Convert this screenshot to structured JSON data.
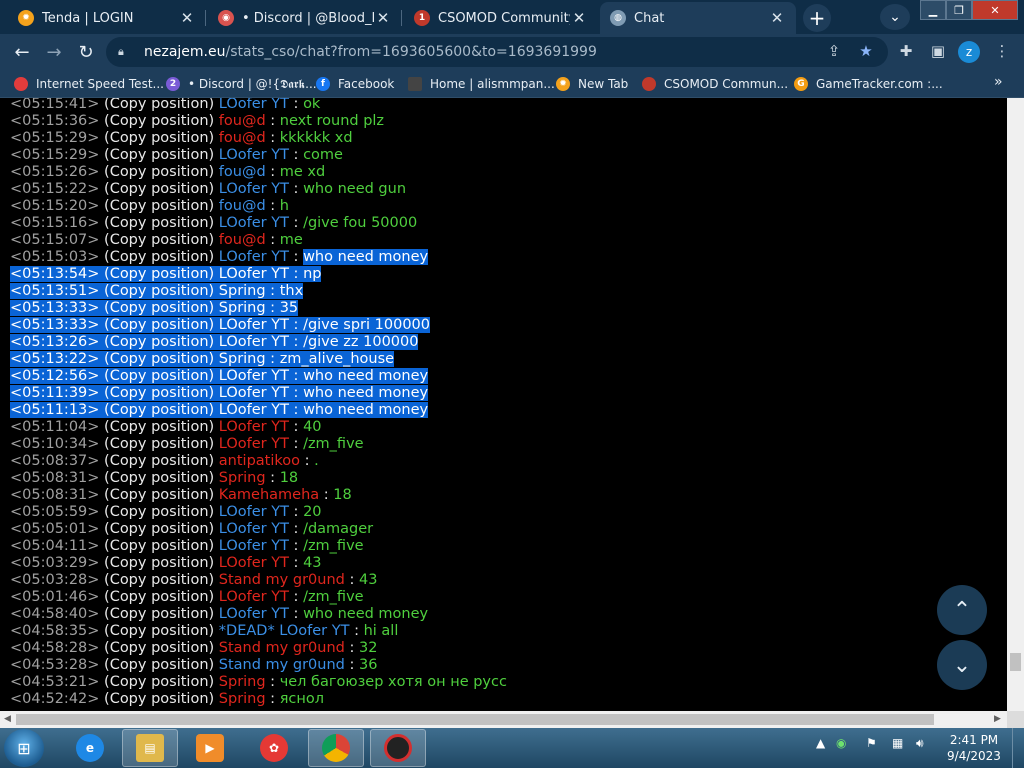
{
  "tabs": [
    {
      "title": "Tenda | LOGIN",
      "icon": "tenda-icon",
      "color": "#f4a21c",
      "badge": ""
    },
    {
      "title": "• Discord | @Blood_Band",
      "icon": "discord-icon",
      "color": "#d9534f",
      "badge": ""
    },
    {
      "title": "CSOMOD Community",
      "icon": "csomod-icon",
      "color": "#c0392b",
      "badge": "1"
    },
    {
      "title": "Chat",
      "icon": "globe-icon",
      "color": "#7f9bb3",
      "badge": ""
    }
  ],
  "address": {
    "host": "nezajem.eu",
    "path": "/stats_cso/chat?from=1693605600&to=1693691999"
  },
  "profile_initial": "z",
  "bookmarks": [
    {
      "label": "Internet Speed Test...",
      "icon": "speedtest-icon",
      "color": "#e23c3c"
    },
    {
      "label": "• Discord | @!{𝕯𝖆𝖗𝖐...",
      "icon": "discord-icon",
      "color": "#7a5bd6",
      "badge": "2"
    },
    {
      "label": "Facebook",
      "icon": "facebook-icon",
      "color": "#1877f2"
    },
    {
      "label": "Home | alismmpan...",
      "icon": "alism-icon",
      "color": "#444444"
    },
    {
      "label": "New Tab",
      "icon": "tenda-icon",
      "color": "#f4a21c"
    },
    {
      "label": "CSOMOD Commun...",
      "icon": "csomod-icon",
      "color": "#c0392b"
    },
    {
      "label": "GameTracker.com :...",
      "icon": "gametracker-icon",
      "color": "#f39c12"
    }
  ],
  "chat": {
    "copy_label": "(Copy position)",
    "separator": " : ",
    "rows": [
      {
        "time": "<05:15:41>",
        "name": "LOofer YT",
        "color": "blue",
        "msg": "ok",
        "hl": false
      },
      {
        "time": "<05:15:36>",
        "name": "fou@d",
        "color": "red",
        "msg": "next round plz",
        "hl": false
      },
      {
        "time": "<05:15:29>",
        "name": "fou@d",
        "color": "red",
        "msg": "kkkkkk xd",
        "hl": false
      },
      {
        "time": "<05:15:29>",
        "name": "LOofer YT",
        "color": "blue",
        "msg": "come",
        "hl": false
      },
      {
        "time": "<05:15:26>",
        "name": "fou@d",
        "color": "blue",
        "msg": "me xd",
        "hl": false
      },
      {
        "time": "<05:15:22>",
        "name": "LOofer YT",
        "color": "blue",
        "msg": "who need gun",
        "hl": false
      },
      {
        "time": "<05:15:20>",
        "name": "fou@d",
        "color": "blue",
        "msg": "h",
        "hl": false
      },
      {
        "time": "<05:15:16>",
        "name": "LOofer YT",
        "color": "blue",
        "msg": "/give fou 50000",
        "hl": false
      },
      {
        "time": "<05:15:07>",
        "name": "fou@d",
        "color": "red",
        "msg": "me",
        "hl": false
      },
      {
        "time": "<05:15:03>",
        "name": "LOofer YT",
        "color": "blue",
        "msg": "who need money",
        "hl": "partial"
      },
      {
        "time": "<05:13:54>",
        "name": "LOofer YT",
        "color": "blue",
        "msg": "np",
        "hl": true
      },
      {
        "time": "<05:13:51>",
        "name": "Spring",
        "color": "red",
        "msg": "thx",
        "hl": true
      },
      {
        "time": "<05:13:33>",
        "name": "Spring",
        "color": "red",
        "msg": "35",
        "hl": true
      },
      {
        "time": "<05:13:33>",
        "name": "LOofer YT",
        "color": "blue",
        "msg": "/give spri 100000",
        "hl": true
      },
      {
        "time": "<05:13:26>",
        "name": "LOofer YT",
        "color": "blue",
        "msg": "/give zz 100000",
        "hl": true
      },
      {
        "time": "<05:13:22>",
        "name": "Spring",
        "color": "red",
        "msg": "zm_alive_house",
        "hl": true
      },
      {
        "time": "<05:12:56>",
        "name": "LOofer YT",
        "color": "blue",
        "msg": "who need money",
        "hl": true
      },
      {
        "time": "<05:11:39>",
        "name": "LOofer YT",
        "color": "blue",
        "msg": "who need money",
        "hl": true
      },
      {
        "time": "<05:11:13>",
        "name": "LOofer YT",
        "color": "blue",
        "msg": "who need money",
        "hl": true
      },
      {
        "time": "<05:11:04>",
        "name": "LOofer YT",
        "color": "red",
        "msg": "40",
        "hl": false
      },
      {
        "time": "<05:10:34>",
        "name": "LOofer YT",
        "color": "red",
        "msg": "/zm_five",
        "hl": false
      },
      {
        "time": "<05:08:37>",
        "name": "antipatikoo",
        "color": "red",
        "msg": ".",
        "hl": false
      },
      {
        "time": "<05:08:31>",
        "name": "Spring",
        "color": "red",
        "msg": "18",
        "hl": false
      },
      {
        "time": "<05:08:31>",
        "name": "Kamehameha",
        "color": "red",
        "msg": "18",
        "hl": false
      },
      {
        "time": "<05:05:59>",
        "name": "LOofer YT",
        "color": "blue",
        "msg": "20",
        "hl": false
      },
      {
        "time": "<05:05:01>",
        "name": "LOofer YT",
        "color": "blue",
        "msg": "/damager",
        "hl": false
      },
      {
        "time": "<05:04:11>",
        "name": "LOofer YT",
        "color": "blue",
        "msg": "/zm_five",
        "hl": false
      },
      {
        "time": "<05:03:29>",
        "name": "LOofer YT",
        "color": "red",
        "msg": "43",
        "hl": false
      },
      {
        "time": "<05:03:28>",
        "name": "Stand my gr0und",
        "color": "red",
        "msg": "43",
        "hl": false
      },
      {
        "time": "<05:01:46>",
        "name": "LOofer YT",
        "color": "red",
        "msg": "/zm_five",
        "hl": false
      },
      {
        "time": "<04:58:40>",
        "name": "LOofer YT",
        "color": "blue",
        "msg": "who need money",
        "hl": false
      },
      {
        "time": "<04:58:35>",
        "name": "*DEAD* LOofer YT",
        "color": "blue",
        "msg": "hi all",
        "hl": false
      },
      {
        "time": "<04:58:28>",
        "name": "Stand my gr0und",
        "color": "red",
        "msg": "32",
        "hl": false
      },
      {
        "time": "<04:53:28>",
        "name": "Stand my gr0und",
        "color": "blue",
        "msg": "36",
        "hl": false
      },
      {
        "time": "<04:53:21>",
        "name": "Spring",
        "color": "red",
        "msg": "чел багоюзер хотя он не русс",
        "hl": false
      },
      {
        "time": "<04:52:42>",
        "name": "Spring",
        "color": "red",
        "msg": "яснол",
        "hl": false
      }
    ]
  },
  "fab": {
    "up_icon": "chevron-up-icon",
    "down_icon": "chevron-down-icon"
  },
  "clock": {
    "time": "2:41 PM",
    "date": "9/4/2023"
  },
  "colors": {
    "red_name": "#e0261d",
    "blue_name": "#3b8fe6",
    "message": "#4fcf3e",
    "highlight": "#0a64d6"
  }
}
